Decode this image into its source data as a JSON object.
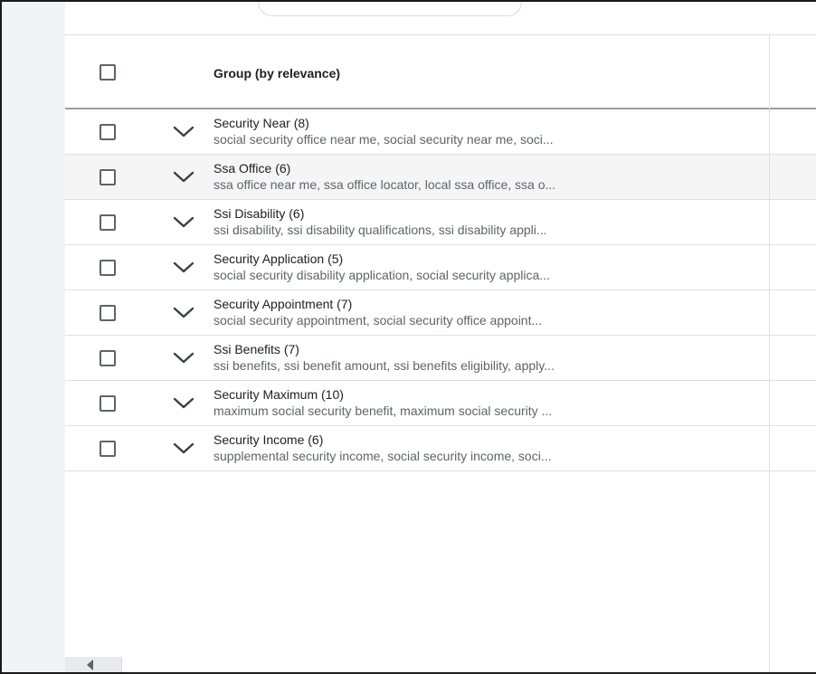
{
  "table": {
    "header": {
      "group_label": "Group (by relevance)"
    },
    "rows": [
      {
        "title": "Security Near (8)",
        "keywords": "social security office near me, social security near me, soci..."
      },
      {
        "title": "Ssa Office (6)",
        "keywords": "ssa office near me, ssa office locator, local ssa office, ssa o..."
      },
      {
        "title": "Ssi Disability (6)",
        "keywords": "ssi disability, ssi disability qualifications, ssi disability appli..."
      },
      {
        "title": "Security Application (5)",
        "keywords": "social security disability application, social security applica..."
      },
      {
        "title": "Security Appointment (7)",
        "keywords": "social security appointment, social security office appoint..."
      },
      {
        "title": "Ssi Benefits (7)",
        "keywords": "ssi benefits, ssi benefit amount, ssi benefits eligibility, apply..."
      },
      {
        "title": "Security Maximum (10)",
        "keywords": "maximum social security benefit, maximum social security ..."
      },
      {
        "title": "Security Income (6)",
        "keywords": "supplemental security income, social security income, soci..."
      }
    ]
  },
  "colors": {
    "rail": "#f1f3f4",
    "row_highlight": "#f5f5f5",
    "header_divider": "#9e9e9e",
    "secondary_text": "#5f6368"
  },
  "icons": {
    "expand": "chevron-down-icon",
    "scroll": "scroll-left-icon"
  }
}
